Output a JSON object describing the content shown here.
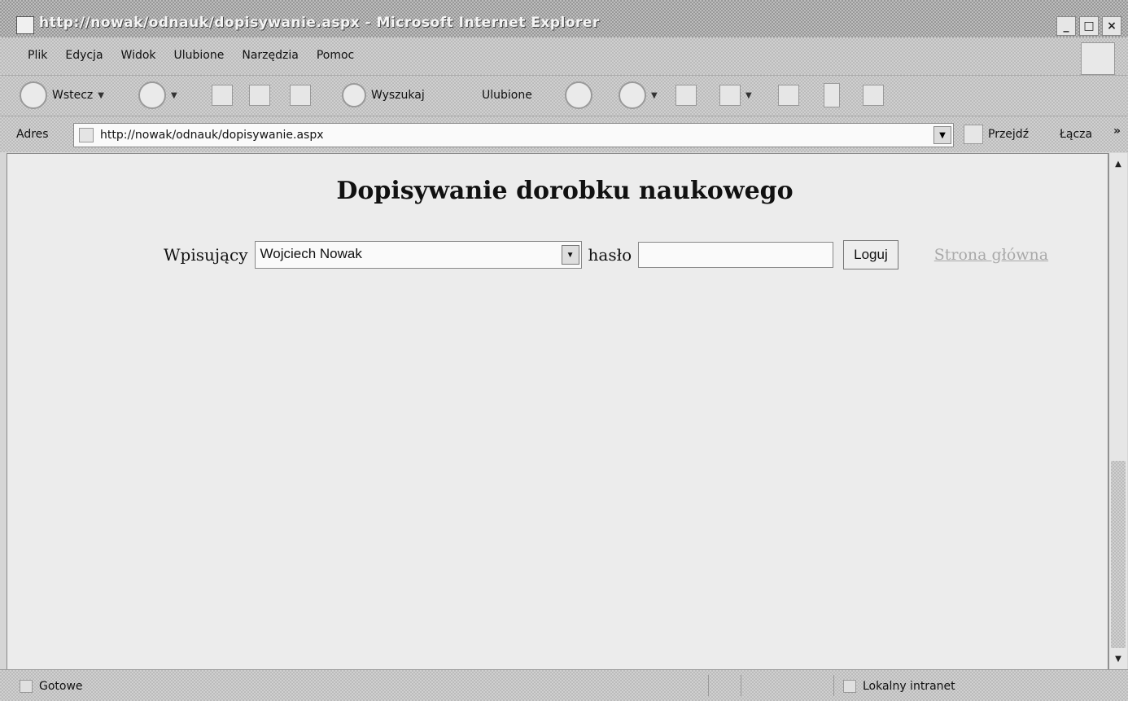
{
  "window": {
    "title": "http://nowak/odnauk/dopisywanie.aspx - Microsoft Internet Explorer",
    "controls": [
      "_",
      "□",
      "×"
    ]
  },
  "menu": {
    "items": [
      "Plik",
      "Edycja",
      "Widok",
      "Ulubione",
      "Narzędzia",
      "Pomoc"
    ]
  },
  "toolbar": {
    "back_label": "Wstecz",
    "search_label": "Wyszukaj",
    "favorites_label": "Ulubione"
  },
  "address": {
    "label": "Adres",
    "url": "http://nowak/odnauk/dopisywanie.aspx",
    "go_label": "Przejdź",
    "links_label": "Łącza",
    "links_chevron": "»"
  },
  "page": {
    "title": "Dopisywanie dorobku naukowego",
    "author_label": "Wpisujący",
    "author_selected": "Wojciech Nowak",
    "password_label": "hasło",
    "password_value": "",
    "login_button": "Loguj",
    "home_link": "Strona główna"
  },
  "status": {
    "left_text": "Gotowe",
    "zone_text": "Lokalny intranet"
  }
}
